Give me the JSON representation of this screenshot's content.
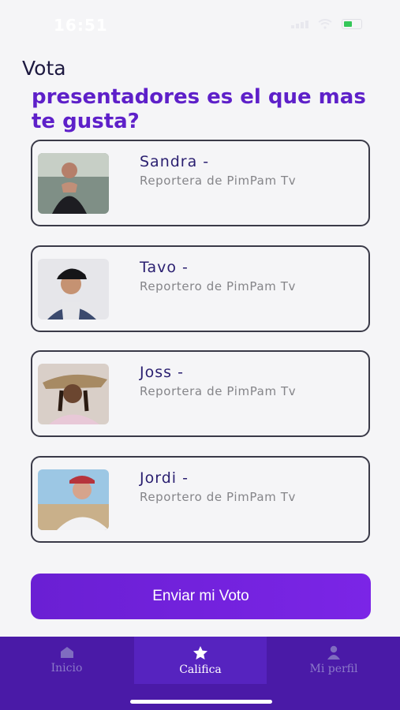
{
  "status_bar": {
    "time": "16:51"
  },
  "header": {
    "title": "Vota",
    "question": "presentadores es el que mas te gusta?"
  },
  "presenters": [
    {
      "name": "Sandra -",
      "role": "Reportera de PimPam Tv"
    },
    {
      "name": "Tavo -",
      "role": "Reportero de PimPam Tv"
    },
    {
      "name": "Joss -",
      "role": "Reportera de PimPam Tv"
    },
    {
      "name": "Jordi -",
      "role": "Reportero de PimPam Tv"
    }
  ],
  "submit_label": "Enviar mi Voto",
  "tabs": [
    {
      "label": "Inicio",
      "icon": "home-icon"
    },
    {
      "label": "Califica",
      "icon": "star-icon"
    },
    {
      "label": "Mi perfil",
      "icon": "person-icon"
    }
  ],
  "colors": {
    "accent": "#6a1fd3",
    "tabbar": "#4a1aa7",
    "title": "#5e20c9"
  }
}
